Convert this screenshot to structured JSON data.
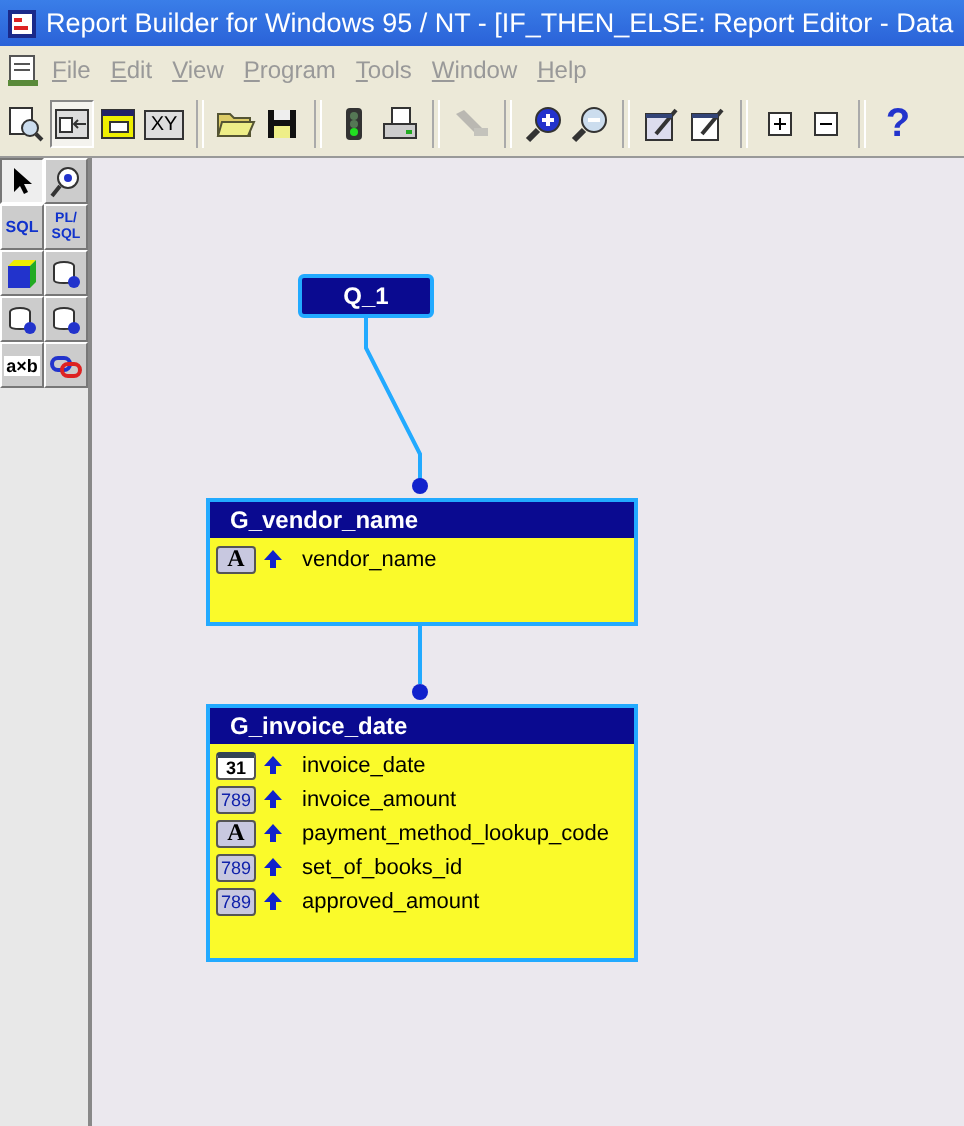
{
  "window": {
    "title": "Report Builder for Windows 95 / NT - [IF_THEN_ELSE: Report Editor - Data"
  },
  "menu": [
    {
      "label": "File",
      "disabled": true
    },
    {
      "label": "Edit",
      "disabled": true
    },
    {
      "label": "View",
      "disabled": true
    },
    {
      "label": "Program",
      "disabled": true
    },
    {
      "label": "Tools",
      "disabled": true
    },
    {
      "label": "Window",
      "disabled": true
    },
    {
      "label": "Help",
      "disabled": true
    }
  ],
  "toolbar": [
    {
      "kind": "preview",
      "pressed": false,
      "disabled": false
    },
    {
      "kind": "data-model",
      "pressed": true,
      "disabled": false
    },
    {
      "kind": "layout",
      "pressed": false,
      "disabled": false
    },
    {
      "kind": "xy",
      "label": "XY",
      "pressed": false,
      "disabled": false
    },
    {
      "kind": "sep"
    },
    {
      "kind": "open",
      "pressed": false,
      "disabled": false
    },
    {
      "kind": "save",
      "pressed": false,
      "disabled": false
    },
    {
      "kind": "sep"
    },
    {
      "kind": "run",
      "pressed": false,
      "disabled": false
    },
    {
      "kind": "print",
      "pressed": false,
      "disabled": false
    },
    {
      "kind": "sep"
    },
    {
      "kind": "brush",
      "pressed": false,
      "disabled": true
    },
    {
      "kind": "sep"
    },
    {
      "kind": "zoom-in",
      "pressed": false,
      "disabled": false
    },
    {
      "kind": "zoom-out",
      "pressed": false,
      "disabled": false
    },
    {
      "kind": "sep"
    },
    {
      "kind": "edit",
      "pressed": false,
      "disabled": false
    },
    {
      "kind": "notes",
      "pressed": false,
      "disabled": false
    },
    {
      "kind": "sep"
    },
    {
      "kind": "expand",
      "pressed": false,
      "disabled": false
    },
    {
      "kind": "collapse",
      "pressed": false,
      "disabled": false
    },
    {
      "kind": "sep"
    },
    {
      "kind": "help",
      "label": "?",
      "pressed": false,
      "disabled": false
    }
  ],
  "palette": [
    {
      "kind": "select",
      "selected": true
    },
    {
      "kind": "magnify",
      "selected": false
    },
    {
      "kind": "text",
      "label": "SQL",
      "selected": false
    },
    {
      "kind": "text2",
      "label": "PL/\nSQL",
      "selected": false
    },
    {
      "kind": "cube",
      "selected": false
    },
    {
      "kind": "summary",
      "selected": false
    },
    {
      "kind": "add",
      "selected": false
    },
    {
      "kind": "query",
      "selected": false
    },
    {
      "kind": "formula",
      "label": "a×b",
      "selected": false
    },
    {
      "kind": "link",
      "selected": false
    }
  ],
  "query": {
    "name": "Q_1"
  },
  "groups": [
    {
      "name": "G_vendor_name",
      "fields": [
        {
          "kind": "char",
          "badge": "A",
          "name": "vendor_name"
        }
      ]
    },
    {
      "name": "G_invoice_date",
      "fields": [
        {
          "kind": "date",
          "badge": "31",
          "name": "invoice_date"
        },
        {
          "kind": "number",
          "badge": "789",
          "name": "invoice_amount"
        },
        {
          "kind": "char",
          "badge": "A",
          "name": "payment_method_lookup_code"
        },
        {
          "kind": "number",
          "badge": "789",
          "name": "set_of_books_id"
        },
        {
          "kind": "number",
          "badge": "789",
          "name": "approved_amount"
        }
      ]
    }
  ]
}
